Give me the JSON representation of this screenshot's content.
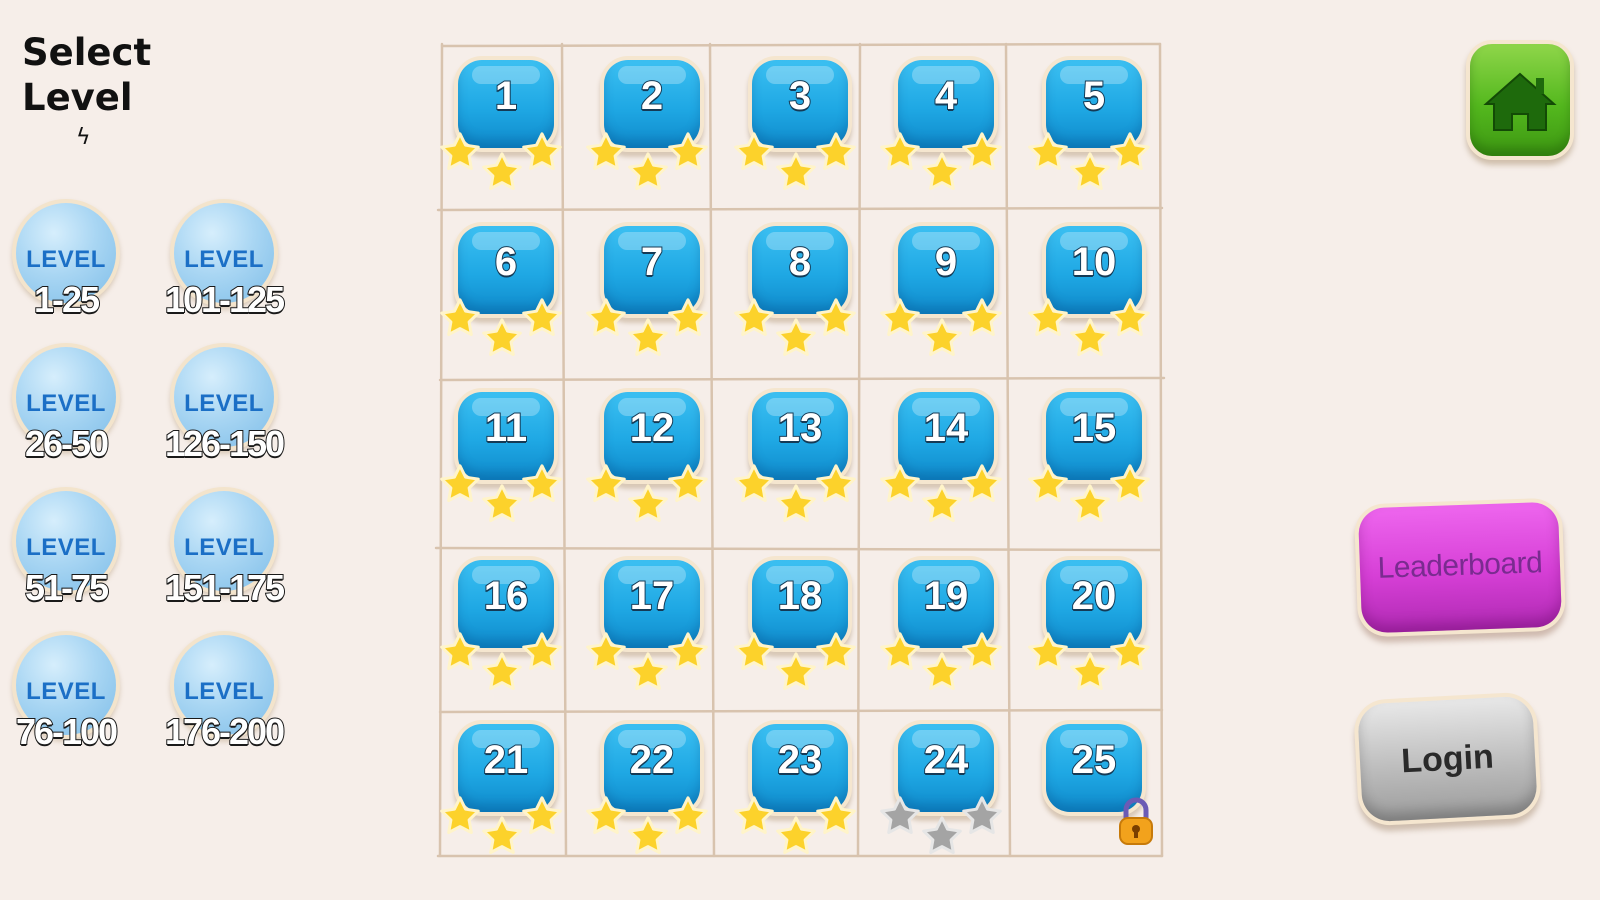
{
  "header": {
    "title_line1": "Select",
    "title_line2": "Level",
    "title_mark": "ϟ"
  },
  "level_ranges": [
    {
      "word": "LEVEL",
      "range": "1-25"
    },
    {
      "word": "LEVEL",
      "range": "101-125"
    },
    {
      "word": "LEVEL",
      "range": "26-50"
    },
    {
      "word": "LEVEL",
      "range": "126-150"
    },
    {
      "word": "LEVEL",
      "range": "51-75"
    },
    {
      "word": "LEVEL",
      "range": "151-175"
    },
    {
      "word": "LEVEL",
      "range": "76-100"
    },
    {
      "word": "LEVEL",
      "range": "176-200"
    }
  ],
  "levels": [
    {
      "number": "1",
      "stars": 3,
      "locked": false
    },
    {
      "number": "2",
      "stars": 3,
      "locked": false
    },
    {
      "number": "3",
      "stars": 3,
      "locked": false
    },
    {
      "number": "4",
      "stars": 3,
      "locked": false
    },
    {
      "number": "5",
      "stars": 3,
      "locked": false
    },
    {
      "number": "6",
      "stars": 3,
      "locked": false
    },
    {
      "number": "7",
      "stars": 3,
      "locked": false
    },
    {
      "number": "8",
      "stars": 3,
      "locked": false
    },
    {
      "number": "9",
      "stars": 3,
      "locked": false
    },
    {
      "number": "10",
      "stars": 3,
      "locked": false
    },
    {
      "number": "11",
      "stars": 3,
      "locked": false
    },
    {
      "number": "12",
      "stars": 3,
      "locked": false
    },
    {
      "number": "13",
      "stars": 3,
      "locked": false
    },
    {
      "number": "14",
      "stars": 3,
      "locked": false
    },
    {
      "number": "15",
      "stars": 3,
      "locked": false
    },
    {
      "number": "16",
      "stars": 3,
      "locked": false
    },
    {
      "number": "17",
      "stars": 3,
      "locked": false
    },
    {
      "number": "18",
      "stars": 3,
      "locked": false
    },
    {
      "number": "19",
      "stars": 3,
      "locked": false
    },
    {
      "number": "20",
      "stars": 3,
      "locked": false
    },
    {
      "number": "21",
      "stars": 3,
      "locked": false
    },
    {
      "number": "22",
      "stars": 3,
      "locked": false
    },
    {
      "number": "23",
      "stars": 3,
      "locked": false
    },
    {
      "number": "24",
      "stars": 0,
      "locked": false
    },
    {
      "number": "25",
      "stars": 0,
      "locked": true
    }
  ],
  "buttons": {
    "home_icon": "home-icon",
    "leaderboard_label": "Leaderboard",
    "login_label": "Login"
  },
  "colors": {
    "background": "#f6eee9",
    "tile_blue": "#1fa8e4",
    "star_gold": "#fcd22b",
    "star_empty": "#a4a4a4",
    "home_green": "#54b81e",
    "leaderboard_magenta": "#d63fd6",
    "login_gray": "#bdbdbd"
  }
}
